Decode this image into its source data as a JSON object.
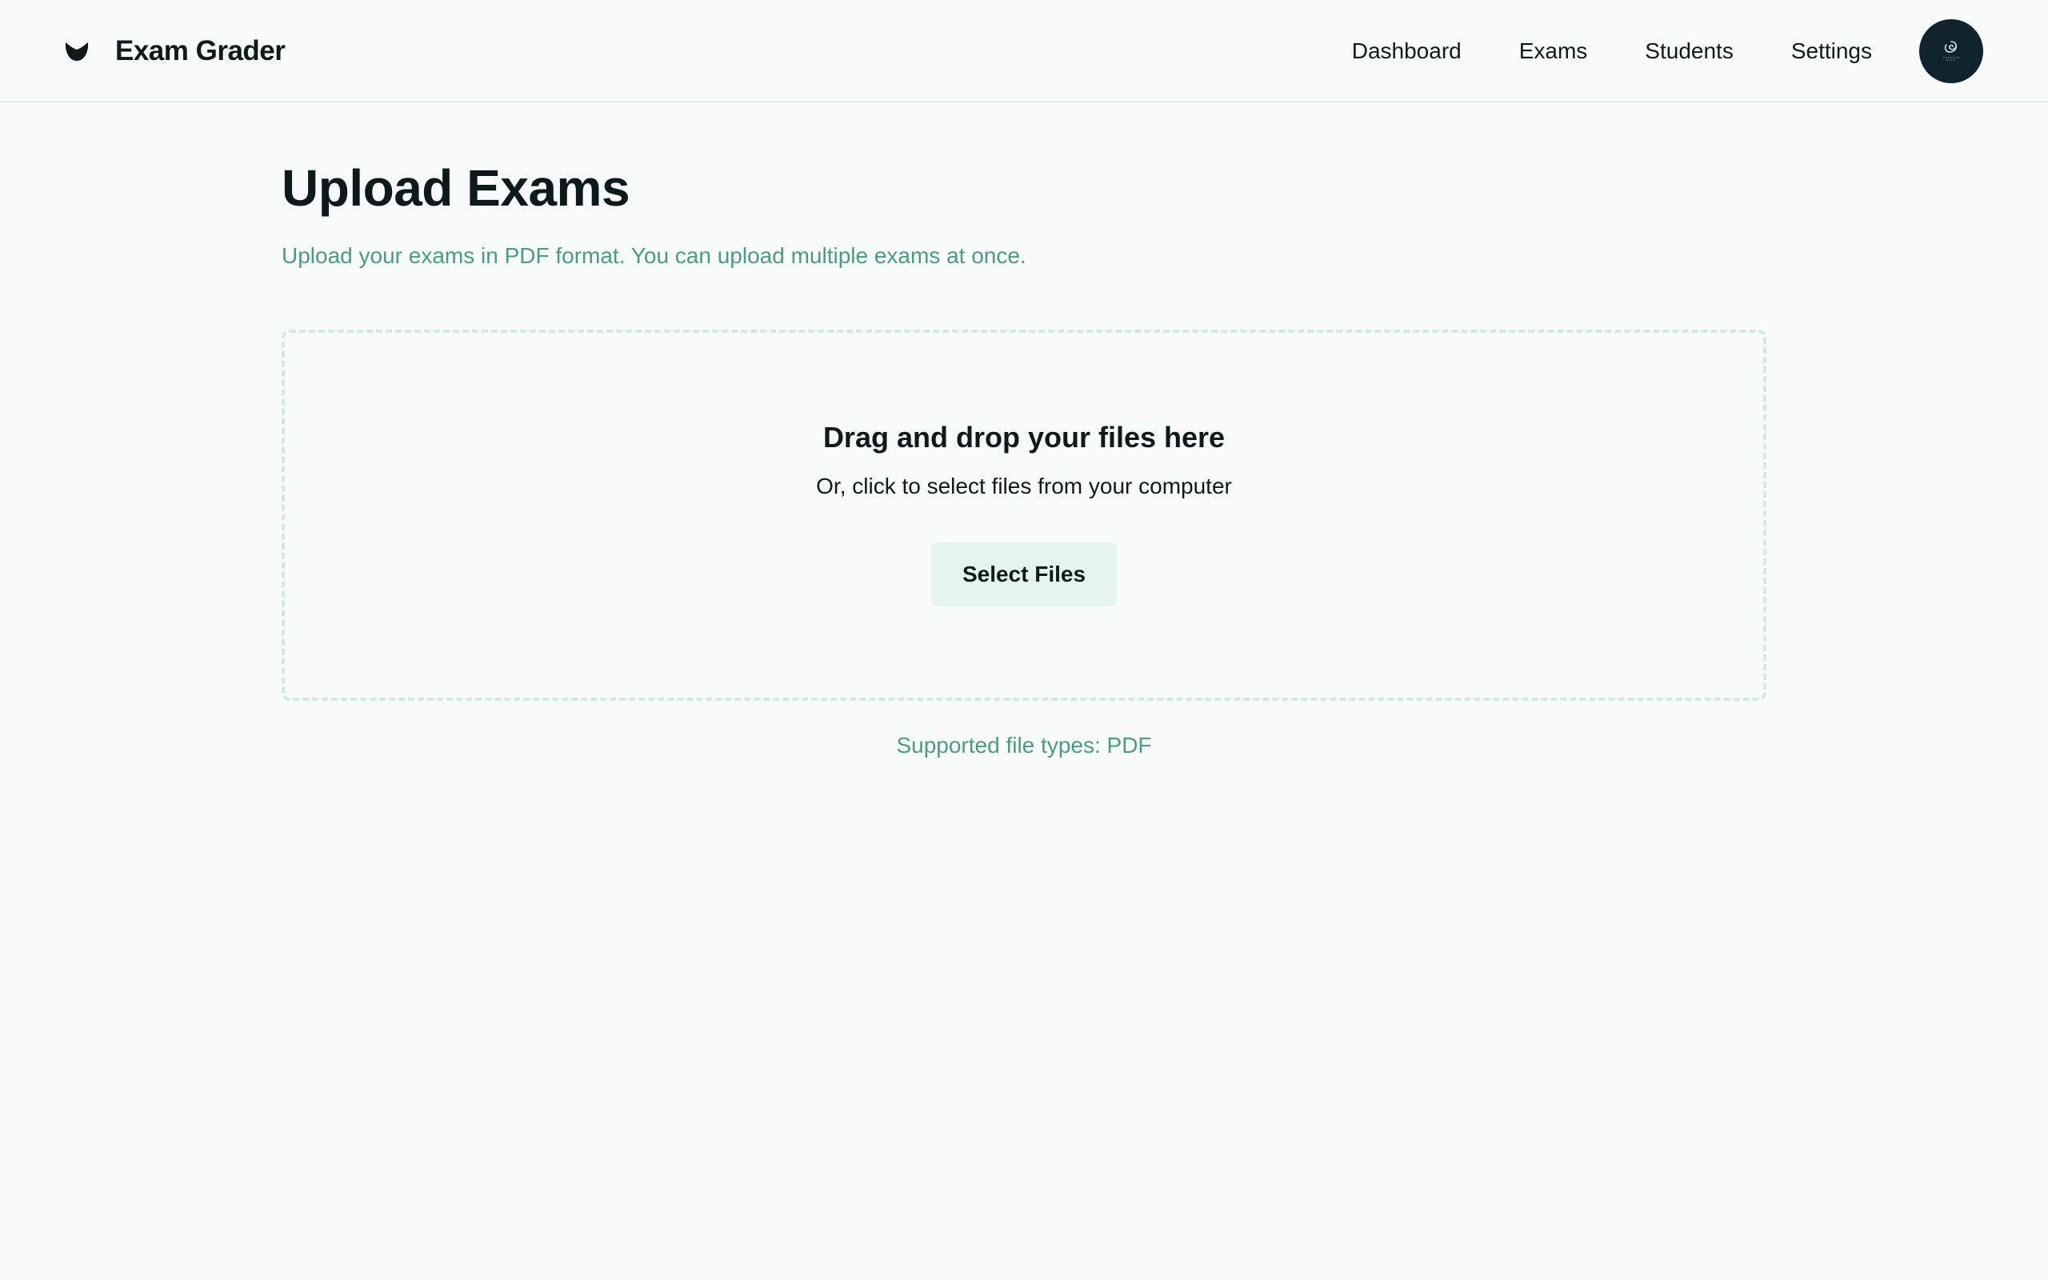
{
  "app": {
    "title": "Exam Grader",
    "logo_icon": "leaf-logo-icon"
  },
  "nav": {
    "items": [
      {
        "label": "Dashboard"
      },
      {
        "label": "Exams"
      },
      {
        "label": "Students"
      },
      {
        "label": "Settings"
      }
    ],
    "avatar_icon": "user-avatar"
  },
  "page": {
    "title": "Upload Exams",
    "subtitle": "Upload your exams in PDF format. You can upload multiple exams at once."
  },
  "dropzone": {
    "title": "Drag and drop your files here",
    "subtitle": "Or, click to select files from your computer",
    "button_label": "Select Files"
  },
  "footer_note": "Supported file types: PDF",
  "colors": {
    "background": "#f7fcfa",
    "text": "#0e1a17",
    "accent_text": "#4b9b7f",
    "button_bg": "#e6f4ef",
    "dropzone_border": "#d2ebe2",
    "avatar_bg": "#10232a"
  }
}
